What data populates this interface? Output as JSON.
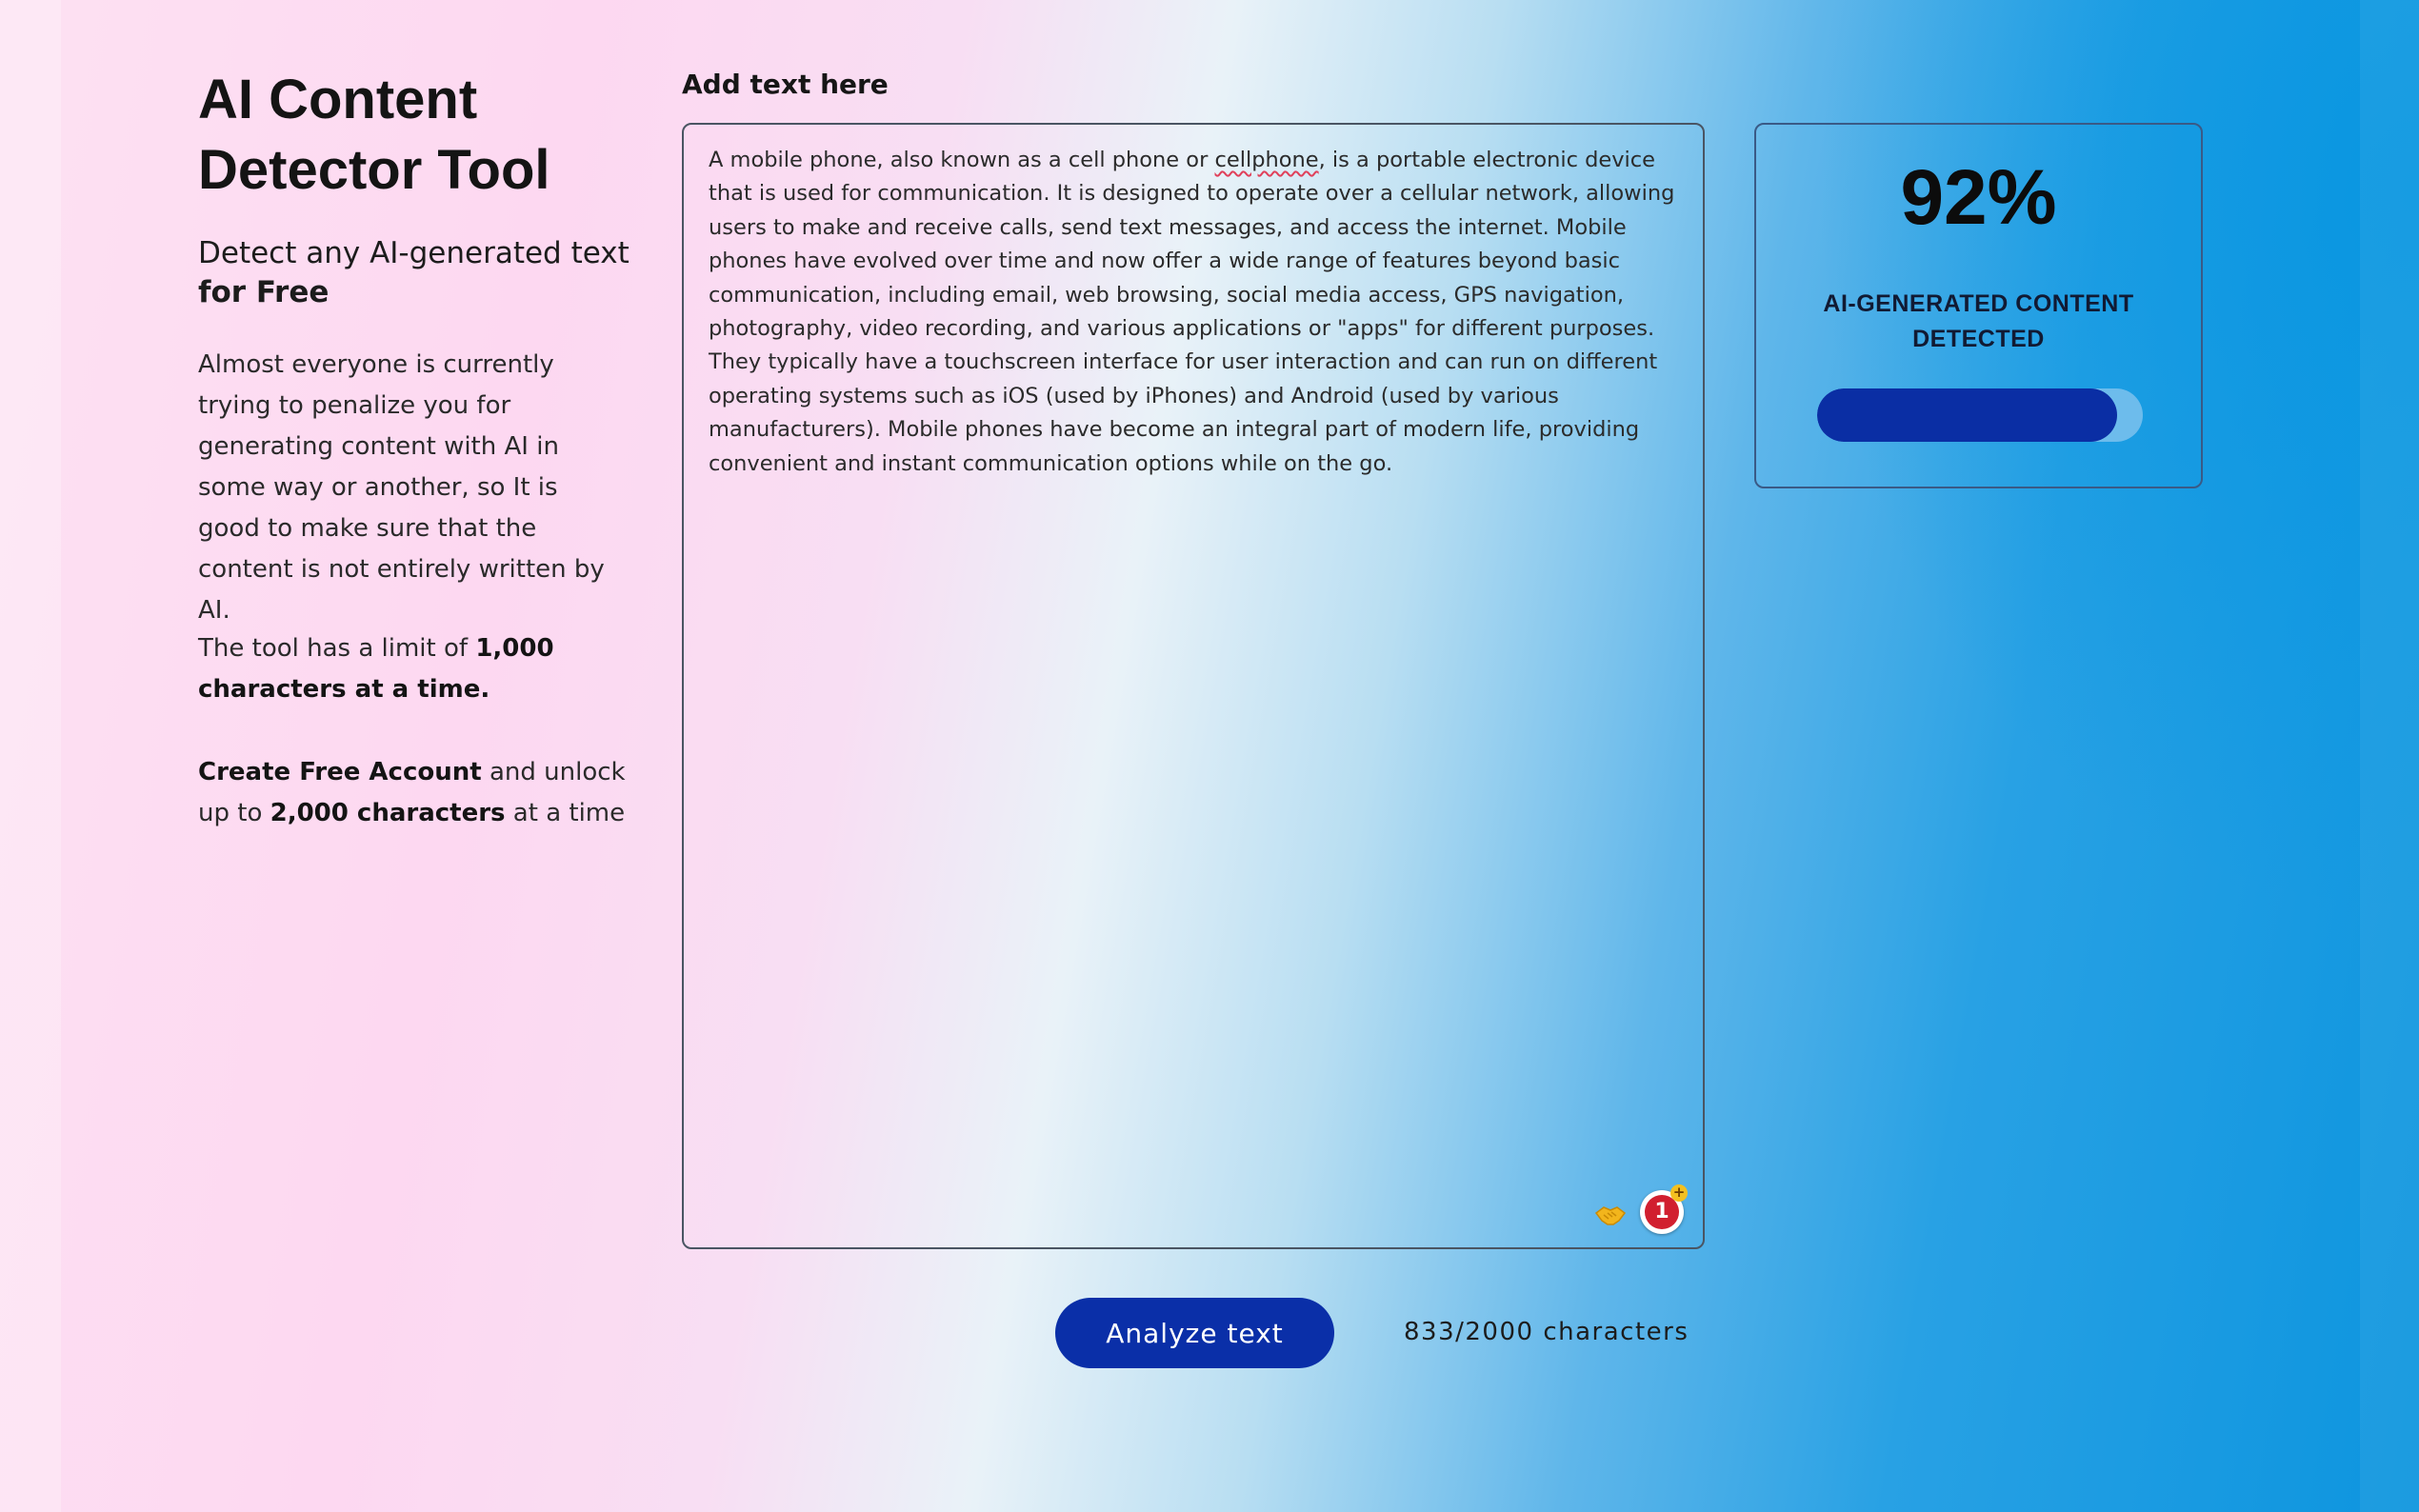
{
  "sidebar": {
    "title": "AI Content Detector Tool",
    "subtitle_prefix": "Detect any AI-generated text",
    "subtitle_bold": "for Free",
    "intro": "Almost everyone is currently trying to penalize you for generating content with AI in some way or another, so It is good to make sure that the content is not entirely written by AI.",
    "limit_prefix": "The tool has a limit of ",
    "limit_bold": "1,000 characters at a time.",
    "account_link": "Create Free Account",
    "account_middle": " and unlock up to ",
    "account_bold": "2,000 characters",
    "account_suffix": " at a time"
  },
  "editor": {
    "label": "Add text here",
    "text_before": "A mobile phone, also known as a cell phone or ",
    "text_misspelled": "cellphone",
    "text_after": ", is a portable electronic device that is used for communication. It is designed to operate over a cellular network, allowing users to make and receive calls, send text messages, and access the internet. Mobile phones have evolved over time and now offer a wide range of features beyond basic communication, including email, web browsing, social media access, GPS navigation, photography, video recording, and various applications or \"apps\" for different purposes. They typically have a touchscreen interface for user interaction and can run on different operating systems such as iOS (used by iPhones) and Android (used by various manufacturers). Mobile phones have become an integral part of modern life, providing convenient and instant communication options while on the go.",
    "extension_badge_count": "1",
    "extension_badge_plus": "+"
  },
  "result": {
    "score": "92%",
    "verdict": "AI-GENERATED CONTENT DETECTED",
    "meter_fraction": 0.92,
    "meter_color": "#0a2ea4",
    "meter_track_color": "#6dbcec"
  },
  "actions": {
    "analyze_label": "Analyze text",
    "char_count": "833/2000 characters"
  },
  "colors": {
    "accent": "#0a2fa8"
  }
}
